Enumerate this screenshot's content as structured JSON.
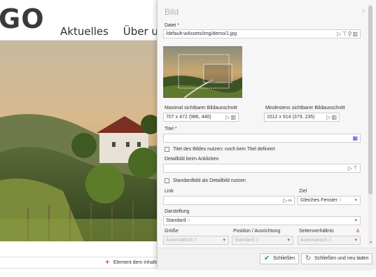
{
  "site": {
    "logo": "GO",
    "nav": [
      "Aktuelles",
      "Über uns"
    ],
    "add_element_label": "Element dem Inhalts"
  },
  "dialog": {
    "title": "Bild",
    "datei_label": "Datei",
    "datei_value": "/default-wAssets/img/demo/1.jpg",
    "max_crop_label": "Maximal sichtbarer Bildausschnitt",
    "max_crop_value": "707 x 472 (986, 440)",
    "min_crop_label": "Mindestens sichtbarer Bildausschnitt",
    "min_crop_value": "1512 x 914 (379, 235)",
    "titel_label": "Titel",
    "titel_value": "",
    "use_title_checkbox_label": "Titel des Bildes nutzen: noch kein Titel definiert",
    "detail_label": "Detailbild beim Anklicken",
    "detail_value": "",
    "standard_detail_checkbox_label": "Standardbild als Detailbild nutzen",
    "link_label": "Link",
    "link_value": "",
    "ziel_label": "Ziel",
    "ziel_value": "Gleiches Fenster",
    "ziel_count": "0",
    "darstellung_label": "Darstellung",
    "darstellung_value": "Standard",
    "darstellung_count": "0",
    "groesse_label": "Größe",
    "groesse_value": "Automatisch",
    "groesse_count": "0",
    "position_label": "Position / Ausrichtung",
    "position_value": "Standard",
    "position_count": "0",
    "ratio_label": "Seitenverhältnis",
    "ratio_value": "Automatisch",
    "ratio_count": "0",
    "save_button": "Schließen",
    "save_reload_button": "Schließen und neu laden"
  },
  "colors": {
    "required": "#d0021b",
    "confirm_icon": "#2e9b3e",
    "add_plus": "#d0021b"
  },
  "icons": [
    "arrow-cursor-icon",
    "filter-icon",
    "search-icon",
    "trash-icon",
    "link-icon",
    "picker-icon",
    "close-icon",
    "check-icon",
    "reload-icon",
    "plus-icon"
  ]
}
